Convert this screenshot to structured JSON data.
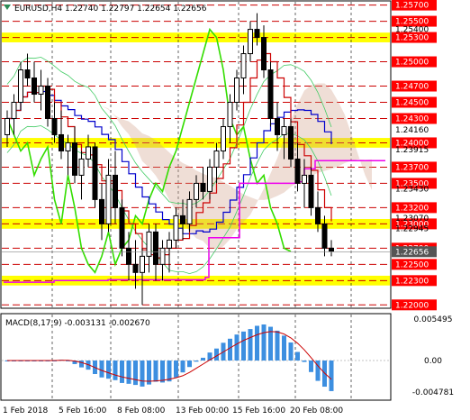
{
  "header": {
    "symbol": "EURUSD,H4",
    "ohlc": "1.22740 1.22797 1.22654 1.22656"
  },
  "macd": {
    "label": "MACD(8,17,9) -0.003131 -0.002670",
    "axis_labels": [
      "0.005495",
      "0.00",
      "-0.004781"
    ]
  },
  "colors": {
    "up_candle": "#000000",
    "yellow_zone": "#ffff00",
    "resistance_line": "#cc0000",
    "tenkan": "#cc0000",
    "kijun": "#0000cc",
    "chikou": "#33dd00",
    "bollinger": "#44cc66",
    "cloud_a": "#d2a08a",
    "ma_line": "#ee00ee",
    "macd_hist": "#3d8fe0",
    "signal": "#cc0000",
    "price_tag": "#ff0000",
    "current_tag": "#555555"
  },
  "price_levels": [
    {
      "price": 1.257,
      "label": "1.25700",
      "tag": "red"
    },
    {
      "price": 1.255,
      "label": "1.25500",
      "tag": "red"
    },
    {
      "price": 1.253,
      "label": "1.25300",
      "tag": "red"
    },
    {
      "price": 1.25,
      "label": "1.25000",
      "tag": "red"
    },
    {
      "price": 1.247,
      "label": "1.24700",
      "tag": "red"
    },
    {
      "price": 1.245,
      "label": "1.24500",
      "tag": "red"
    },
    {
      "price": 1.243,
      "label": "1.24300",
      "tag": "red"
    },
    {
      "price": 1.24,
      "label": "1.24000",
      "tag": "red"
    },
    {
      "price": 1.237,
      "label": "1.23700",
      "tag": "red"
    },
    {
      "price": 1.235,
      "label": "1.23500",
      "tag": "red"
    },
    {
      "price": 1.232,
      "label": "1.23200",
      "tag": "red"
    },
    {
      "price": 1.23,
      "label": "1.23000",
      "tag": "red"
    },
    {
      "price": 1.227,
      "label": "1.22700",
      "tag": "red"
    },
    {
      "price": 1.225,
      "label": "1.22500",
      "tag": "red"
    },
    {
      "price": 1.223,
      "label": "1.22300",
      "tag": "red"
    },
    {
      "price": 1.22,
      "label": "1.22000",
      "tag": "red"
    }
  ],
  "axis_plain_labels": [
    {
      "price": 1.254,
      "label": "1.25400"
    },
    {
      "price": 1.2416,
      "label": "1.24160"
    },
    {
      "price": 1.23915,
      "label": "1.23915"
    },
    {
      "price": 1.2343,
      "label": "1.23430"
    },
    {
      "price": 1.2307,
      "label": "1.23070"
    },
    {
      "price": 1.22945,
      "label": "1.22945"
    }
  ],
  "current_price": {
    "price": 1.22656,
    "label": "1.22656"
  },
  "yellow_zones": [
    {
      "top": 1.2536,
      "bottom": 1.2524,
      "label": "1.25300"
    },
    {
      "top": 1.2406,
      "bottom": 1.2394,
      "label": "1.24000"
    },
    {
      "top": 1.2306,
      "bottom": 1.2294,
      "label": "1.23000"
    },
    {
      "top": 1.2236,
      "bottom": 1.2224,
      "label": "1.22300"
    }
  ],
  "time_labels": [
    "1 Feb 2018",
    "5 Feb 16:00",
    "8 Feb 08:00",
    "13 Feb 00:00",
    "15 Feb 16:00",
    "20 Feb 08:00"
  ],
  "price_range": {
    "max": 1.2574,
    "min": 1.2197
  },
  "chart_data": {
    "type": "candlestick",
    "title": "EURUSD,H4",
    "ylim": [
      1.2197,
      1.2574
    ],
    "candles": [
      [
        1.241,
        1.244,
        1.2395,
        1.243
      ],
      [
        1.243,
        1.246,
        1.241,
        1.245
      ],
      [
        1.245,
        1.25,
        1.244,
        1.249
      ],
      [
        1.249,
        1.251,
        1.247,
        1.248
      ],
      [
        1.248,
        1.25,
        1.245,
        1.246
      ],
      [
        1.246,
        1.249,
        1.244,
        1.247
      ],
      [
        1.247,
        1.248,
        1.242,
        1.243
      ],
      [
        1.243,
        1.245,
        1.24,
        1.241
      ],
      [
        1.241,
        1.244,
        1.238,
        1.239
      ],
      [
        1.239,
        1.241,
        1.236,
        1.24
      ],
      [
        1.24,
        1.242,
        1.235,
        1.236
      ],
      [
        1.236,
        1.239,
        1.233,
        1.238
      ],
      [
        1.238,
        1.241,
        1.237,
        1.2395
      ],
      [
        1.2395,
        1.24,
        1.232,
        1.233
      ],
      [
        1.233,
        1.235,
        1.228,
        1.23
      ],
      [
        1.23,
        1.238,
        1.229,
        1.236
      ],
      [
        1.236,
        1.239,
        1.23,
        1.232
      ],
      [
        1.232,
        1.233,
        1.226,
        1.227
      ],
      [
        1.227,
        1.229,
        1.223,
        1.225
      ],
      [
        1.225,
        1.228,
        1.222,
        1.224
      ],
      [
        1.224,
        1.227,
        1.22,
        1.226
      ],
      [
        1.226,
        1.23,
        1.224,
        1.229
      ],
      [
        1.229,
        1.23,
        1.223,
        1.225
      ],
      [
        1.225,
        1.228,
        1.223,
        1.227
      ],
      [
        1.227,
        1.229,
        1.224,
        1.228
      ],
      [
        1.228,
        1.232,
        1.227,
        1.231
      ],
      [
        1.231,
        1.233,
        1.228,
        1.23
      ],
      [
        1.23,
        1.234,
        1.229,
        1.233
      ],
      [
        1.233,
        1.236,
        1.232,
        1.235
      ],
      [
        1.235,
        1.237,
        1.233,
        1.234
      ],
      [
        1.234,
        1.238,
        1.233,
        1.237
      ],
      [
        1.237,
        1.24,
        1.235,
        1.239
      ],
      [
        1.239,
        1.243,
        1.238,
        1.242
      ],
      [
        1.242,
        1.246,
        1.24,
        1.245
      ],
      [
        1.245,
        1.249,
        1.244,
        1.248
      ],
      [
        1.248,
        1.252,
        1.246,
        1.251
      ],
      [
        1.251,
        1.255,
        1.25,
        1.254
      ],
      [
        1.254,
        1.256,
        1.252,
        1.253
      ],
      [
        1.253,
        1.2545,
        1.248,
        1.249
      ],
      [
        1.249,
        1.25,
        1.242,
        1.243
      ],
      [
        1.243,
        1.245,
        1.239,
        1.241
      ],
      [
        1.241,
        1.243,
        1.238,
        1.242
      ],
      [
        1.242,
        1.243,
        1.237,
        1.238
      ],
      [
        1.238,
        1.24,
        1.234,
        1.235
      ],
      [
        1.235,
        1.238,
        1.232,
        1.236
      ],
      [
        1.236,
        1.237,
        1.231,
        1.232
      ],
      [
        1.232,
        1.234,
        1.229,
        1.23
      ],
      [
        1.23,
        1.231,
        1.226,
        1.227
      ],
      [
        1.227,
        1.228,
        1.226,
        1.2266
      ]
    ]
  }
}
